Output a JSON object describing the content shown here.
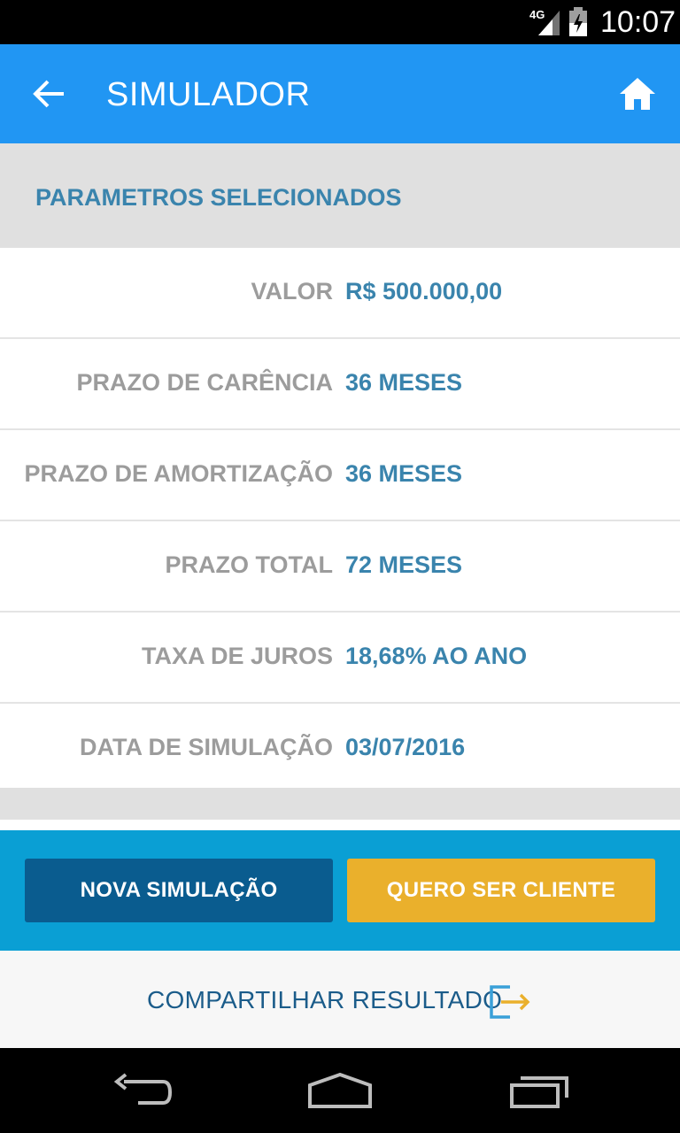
{
  "status_bar": {
    "network": "4G",
    "time": "10:07"
  },
  "app_bar": {
    "title": "SIMULADOR",
    "back_icon": "arrow-left-icon",
    "home_icon": "home-icon"
  },
  "section": {
    "header": "PARAMETROS SELECIONADOS"
  },
  "params": [
    {
      "label": "VALOR",
      "value": "R$ 500.000,00"
    },
    {
      "label": "PRAZO DE CARÊNCIA",
      "value": "36 MESES"
    },
    {
      "label": "PRAZO DE AMORTIZAÇÃO",
      "value": "36 MESES"
    },
    {
      "label": "PRAZO TOTAL",
      "value": "72 MESES"
    },
    {
      "label": "TAXA DE JUROS",
      "value": "18,68% AO ANO"
    },
    {
      "label": "DATA DE SIMULAÇÃO",
      "value": "03/07/2016"
    }
  ],
  "actions": {
    "new_simulation": "NOVA SIMULAÇÃO",
    "become_client": "QUERO SER CLIENTE"
  },
  "share": {
    "label": "COMPARTILHAR RESULTADO",
    "icon": "share-exit-icon"
  },
  "nav": {
    "back": "nav-back-icon",
    "home": "nav-home-icon",
    "recents": "nav-recents-icon"
  },
  "colors": {
    "app_bar": "#2196f3",
    "accent_text": "#3a84ad",
    "action_bg": "#0a9fd4",
    "btn_primary": "#0a5c8f",
    "btn_secondary": "#eab02c"
  }
}
